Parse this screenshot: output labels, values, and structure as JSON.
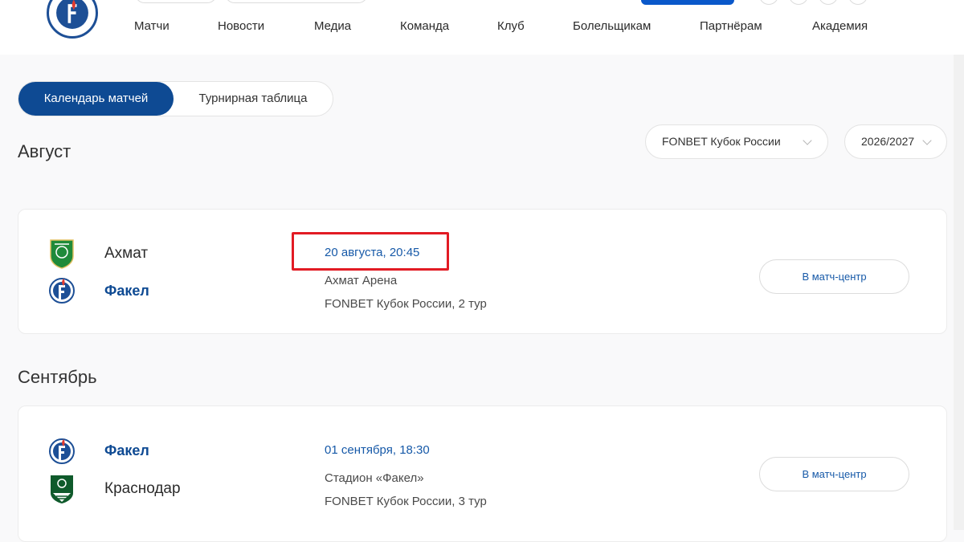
{
  "nav": {
    "items": [
      "Матчи",
      "Новости",
      "Медиа",
      "Команда",
      "Клуб",
      "Болельщикам",
      "Партнёрам",
      "Академия"
    ]
  },
  "tabs": {
    "active": "Календарь матчей",
    "other": "Турнирная таблица"
  },
  "filters": {
    "tournament": "FONBET Кубок России",
    "season": "2026/2027"
  },
  "months": {
    "first": "Август",
    "second": "Сентябрь"
  },
  "matches": [
    {
      "home": "Ахмат",
      "away": "Факел",
      "datetime": "20 августа, 20:45",
      "venue": "Ахмат Арена",
      "stage": "FONBET Кубок России, 2 тур",
      "button": "В матч-центр"
    },
    {
      "home": "Факел",
      "away": "Краснодар",
      "datetime": "01 сентября, 18:30",
      "venue": "Стадион «Факел»",
      "stage": "FONBET Кубок России, 3 тур",
      "button": "В матч-центр"
    }
  ],
  "colors": {
    "brand": "#0e4a93",
    "link": "#1659a8",
    "highlight": "#e21b24",
    "akhmat": "#1f8a3a",
    "krasnodar": "#0f5a2b"
  }
}
